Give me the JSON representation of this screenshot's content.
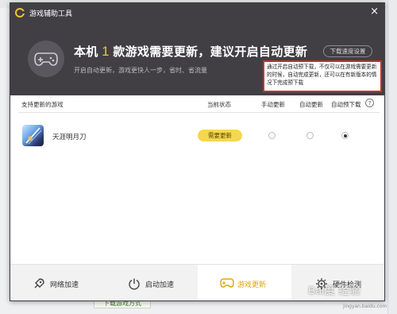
{
  "window": {
    "title": "游戏辅助工具",
    "close_label": "×"
  },
  "header": {
    "headline_prefix": "本机",
    "headline_count": "1",
    "headline_suffix": "款游戏需要更新，建议开启自动更新",
    "subline": "开启自动更新，游戏更快人一步，省时、省流量",
    "speed_button": "下载速度设置",
    "tooltip": "通过开启自动预下载，不仅可以在游戏需要更新的时候，自动完成更新，还可以在有新版本的情况下完成预下载"
  },
  "table": {
    "columns": [
      "支持更新的游戏",
      "当前状态",
      "手动更新",
      "自动更新",
      "自动预下载"
    ],
    "help_label": "?",
    "rows": [
      {
        "name": "天涯明月刀",
        "status": "需要更新",
        "selected": "自动预下载"
      }
    ]
  },
  "footer": {
    "tabs": [
      {
        "label": "网络加速",
        "icon": "rocket-icon",
        "active": false
      },
      {
        "label": "启动加速",
        "icon": "power-icon",
        "active": false
      },
      {
        "label": "游戏更新",
        "icon": "gamepad-icon",
        "active": true
      },
      {
        "label": "硬件检测",
        "icon": "gear-icon",
        "active": false
      }
    ]
  },
  "background": {
    "bottom_button": "下载游戏方式"
  },
  "watermark": {
    "text": "Bai度 经验",
    "sub": "jingyan.baidu.com"
  },
  "colors": {
    "header_bg": "#413f44",
    "accent_yellow": "#f1c232",
    "badge_yellow": "#f5d74f",
    "tooltip_border": "#c9302c",
    "active_tab_text": "#e0a800"
  }
}
